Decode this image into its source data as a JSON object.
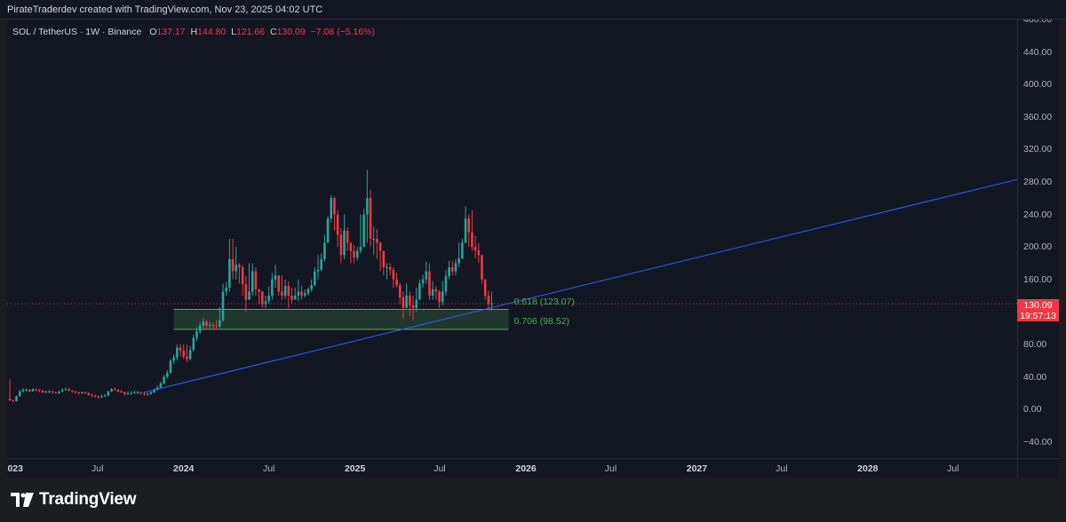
{
  "header": {
    "created_text": "PirateTraderdev created with TradingView.com, Nov 23, 2025 04:02 UTC"
  },
  "legend": {
    "symbol": "SOL / TetherUS · 1W · Binance",
    "open_key": "O",
    "open": "137.17",
    "high_key": "H",
    "high": "144.80",
    "low_key": "L",
    "low": "121.66",
    "close_key": "C",
    "close": "130.09",
    "change": "−7.08 (−5.16%)"
  },
  "price_badge": {
    "price": "130.09",
    "countdown": "19:57:13"
  },
  "fib": {
    "level1_label": "0.618 (123.07)",
    "level2_label": "0.706 (98.52)"
  },
  "footer": {
    "brand": "TradingView"
  },
  "colors": {
    "up": "#26a69a",
    "down": "#f23645",
    "trendline": "#2962ff",
    "fib": "#4caf50",
    "background": "#131722"
  },
  "chart_data": {
    "type": "candlestick",
    "interval": "1W",
    "price_scale": "right",
    "ylim": [
      -60,
      480
    ],
    "y_ticks": [
      "480.00",
      "440.00",
      "400.00",
      "360.00",
      "320.00",
      "280.00",
      "240.00",
      "200.00",
      "160.00",
      "120.00",
      "80.00",
      "40.00",
      "0.00",
      "−40.00"
    ],
    "y_tick_values": [
      480,
      440,
      400,
      360,
      320,
      280,
      240,
      200,
      160,
      120,
      80,
      40,
      0,
      -40
    ],
    "x_ticks": [
      {
        "label": "2023",
        "date": "2023-01-01",
        "year": true
      },
      {
        "label": "Jul",
        "date": "2023-07-01",
        "year": false
      },
      {
        "label": "2024",
        "date": "2024-01-01",
        "year": true
      },
      {
        "label": "Jul",
        "date": "2024-07-01",
        "year": false
      },
      {
        "label": "2025",
        "date": "2025-01-01",
        "year": true
      },
      {
        "label": "Jul",
        "date": "2025-07-01",
        "year": false
      },
      {
        "label": "2026",
        "date": "2026-01-01",
        "year": true
      },
      {
        "label": "Jul",
        "date": "2026-07-01",
        "year": false
      },
      {
        "label": "2027",
        "date": "2027-01-01",
        "year": true
      },
      {
        "label": "Jul",
        "date": "2027-07-01",
        "year": false
      },
      {
        "label": "2028",
        "date": "2028-01-01",
        "year": true
      },
      {
        "label": "Jul",
        "date": "2028-07-01",
        "year": false
      }
    ],
    "x_range": [
      "2022-12-20",
      "2028-11-15"
    ],
    "candles_first_week": "2022-12-26",
    "candle_closes": [
      11,
      10,
      16,
      22,
      24,
      24,
      22,
      25,
      24,
      23,
      21,
      22,
      22,
      21,
      20,
      22,
      24,
      25,
      23,
      22,
      21,
      20,
      21,
      20,
      18,
      17,
      16,
      15,
      16,
      17,
      22,
      25,
      24,
      22,
      21,
      19,
      20,
      20,
      21,
      21,
      20,
      19,
      19,
      21,
      24,
      27,
      32,
      40,
      45,
      60,
      64,
      76,
      72,
      65,
      62,
      73,
      88,
      96,
      103,
      108,
      103,
      104,
      103,
      102,
      110,
      145,
      150,
      185,
      170,
      178,
      175,
      154,
      135,
      145,
      170,
      148,
      145,
      130,
      133,
      140,
      160,
      165,
      145,
      140,
      152,
      140,
      135,
      140,
      145,
      140,
      143,
      148,
      153,
      170,
      172,
      185,
      205,
      235,
      260,
      240,
      215,
      190,
      220,
      205,
      195,
      187,
      195,
      200,
      240,
      260,
      210,
      210,
      205,
      195,
      175,
      175,
      172,
      160,
      153,
      138,
      125,
      140,
      128,
      125,
      135,
      155,
      160,
      170,
      140,
      148,
      145,
      132,
      145,
      164,
      175,
      170,
      180,
      186,
      205,
      235,
      218,
      200,
      196,
      190,
      160,
      140,
      130,
      130.09
    ],
    "candle_highs": [
      37,
      12,
      17,
      24,
      26,
      26,
      25,
      26,
      26,
      25,
      24,
      23,
      24,
      23,
      22,
      23,
      26,
      27,
      26,
      24,
      23,
      22,
      22,
      22,
      21,
      19,
      18,
      17,
      18,
      19,
      23,
      26,
      27,
      25,
      24,
      22,
      22,
      22,
      23,
      23,
      22,
      22,
      21,
      22,
      26,
      29,
      34,
      42,
      48,
      62,
      68,
      80,
      80,
      80,
      80,
      78,
      92,
      101,
      107,
      112,
      110,
      108,
      107,
      110,
      126,
      155,
      157,
      210,
      210,
      200,
      180,
      178,
      164,
      180,
      180,
      175,
      148,
      146,
      140,
      151,
      168,
      178,
      165,
      165,
      160,
      158,
      150,
      150,
      160,
      152,
      148,
      150,
      160,
      175,
      190,
      192,
      215,
      238,
      264,
      262,
      245,
      223,
      240,
      224,
      206,
      202,
      200,
      240,
      247,
      295,
      270,
      225,
      222,
      207,
      195,
      180,
      180,
      175,
      168,
      156,
      145,
      155,
      145,
      140,
      150,
      160,
      166,
      182,
      180,
      158,
      152,
      147,
      158,
      171,
      183,
      183,
      185,
      205,
      210,
      250,
      240,
      245,
      214,
      205,
      180,
      160,
      146,
      144.8
    ],
    "candle_lows": [
      10,
      9,
      10,
      16,
      21,
      22,
      21,
      22,
      22,
      21,
      20,
      20,
      20,
      19,
      19,
      19,
      21,
      23,
      22,
      20,
      19,
      18,
      19,
      19,
      17,
      15,
      14,
      13,
      14,
      15,
      16,
      21,
      23,
      21,
      20,
      17,
      18,
      18,
      19,
      19,
      18,
      17,
      17,
      18,
      20,
      23,
      26,
      31,
      38,
      44,
      56,
      60,
      65,
      62,
      58,
      60,
      71,
      84,
      93,
      99,
      98,
      99,
      98,
      98,
      100,
      108,
      140,
      145,
      160,
      160,
      155,
      140,
      120,
      135,
      140,
      140,
      130,
      125,
      125,
      130,
      135,
      150,
      140,
      135,
      136,
      125,
      130,
      135,
      133,
      135,
      138,
      140,
      145,
      152,
      160,
      170,
      182,
      205,
      230,
      220,
      200,
      180,
      185,
      195,
      180,
      180,
      183,
      192,
      205,
      205,
      200,
      190,
      185,
      170,
      165,
      160,
      165,
      150,
      150,
      130,
      112,
      125,
      115,
      110,
      120,
      135,
      150,
      155,
      135,
      135,
      135,
      125,
      128,
      140,
      160,
      165,
      165,
      175,
      185,
      210,
      200,
      195,
      186,
      180,
      155,
      135,
      122,
      121.66
    ],
    "trendline": {
      "start": {
        "date": "2023-10-09",
        "price": 21
      },
      "end": {
        "date": "2028-11-15",
        "price": 283
      }
    },
    "fib_zone": {
      "start_date": "2023-12-11",
      "end_date": "2025-11-25",
      "top": 123.07,
      "bottom": 98.52
    },
    "current_price": 130.09
  }
}
